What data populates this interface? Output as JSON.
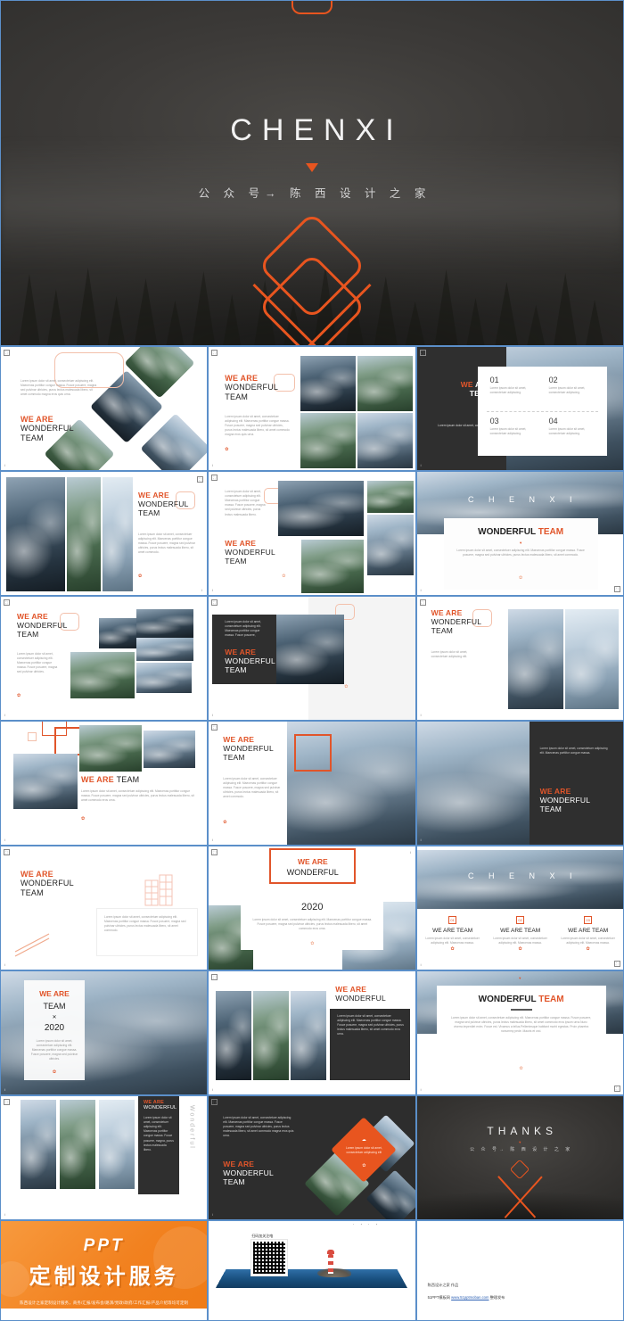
{
  "hero": {
    "title": "CHENXI",
    "subtitle": "公 众 号→ 陈 西 设 计 之 家",
    "caret_icon": "triangle-down-icon",
    "accent_color": "#e8551f",
    "background_color": "#3a3937"
  },
  "slides": [
    {
      "id": 1,
      "headline_orange": "WE ARE",
      "headline_dark": "WONDERFUL\nTEAM",
      "body": "Lorem ipsum dolor sit amet, consectetuer adipiscing elit. Maecenas porttitor congue massa. Fusce posuere, magna sed pulvinar ultricies, purus lectus malesuada libero, sit amet commodo magna eros quis urna.",
      "layout": "diamond-photo-collage"
    },
    {
      "id": 2,
      "headline_orange": "WE ARE",
      "headline_dark": "WONDERFUL\nTEAM",
      "body": "Lorem ipsum dolor sit amet, consectetuer adipiscing elit. Maecenas porttitor congue massa. Fusce posuere, magna sed pulvinar ultricies, purus lectus malesuada libero, sit amet commodo magna eros quis urna.",
      "layout": "left-text-photo-grid"
    },
    {
      "id": 3,
      "headline_orange": "WE",
      "headline_dark": "ARE\nTEAM",
      "body": "Lorem ipsum dolor sit amet, consectetuer adipiscing",
      "layout": "dark-panel-numbered-card",
      "cards": [
        {
          "number": "01",
          "text": "Lorem ipsum dolor sit amet, consectetuer adipiscing."
        },
        {
          "number": "02",
          "text": "Lorem ipsum dolor sit amet, consectetuer adipiscing."
        },
        {
          "number": "03",
          "text": "Lorem ipsum dolor sit amet, consectetuer adipiscing."
        },
        {
          "number": "04",
          "text": "Lorem ipsum dolor sit amet, consectetuer adipiscing."
        }
      ]
    },
    {
      "id": 4,
      "headline_orange": "WE ARE",
      "headline_dark": "WONDERFUL\nTEAM",
      "body": "Lorem ipsum dolor sit amet, consectetuer adipiscing elit. Maecenas porttitor congue massa. Fusce posuere, magna sed pulvinar ultricies, purus lectus malesuada libero, sit amet commodo.",
      "layout": "three-vertical-photos-right-text"
    },
    {
      "id": 5,
      "headline_orange": "WE ARE",
      "headline_dark": "WONDERFUL\nTEAM",
      "body": "Lorem ipsum dolor sit amet, consectetuer adipiscing elit. Maecenas porttitor congue massa. Fusce posuere, magna sed pulvinar ultricies, purus lectus malesuada libero.",
      "layout": "text-top-left-photo-grid"
    },
    {
      "id": 6,
      "title": "C H E N X I",
      "headline_dark": "WONDERFUL",
      "headline_orange": "TEAM",
      "body": "Lorem ipsum dolor sit amet, consectetuer adipiscing elit. Maecenas porttitor congue massa. Fusce posuere, magna sed pulvinar ultricies, purus lectus malesuada libero, sit amet commodo.",
      "layout": "full-photo-centered-card"
    },
    {
      "id": 7,
      "headline_orange": "WE ARE",
      "headline_dark": "WONDERFUL\nTEAM",
      "body": "Lorem ipsum dolor sit amet, consectetuer adipiscing elit. Maecenas porttitor congue massa. Fusce posuere, magna sed pulvinar ultricies.",
      "layout": "left-text-photo-mosaic"
    },
    {
      "id": 8,
      "headline_orange": "WE ARE",
      "headline_dark": "WONDERFUL\nTEAM",
      "body": "Lorem ipsum dolor sit amet, consectetuer adipiscing elit. Maecenas porttitor congue massa. Fusce posuere,",
      "layout": "dark-banner-wide-photo"
    },
    {
      "id": 9,
      "headline_orange": "WE ARE",
      "headline_dark": "WONDERFUL\nTEAM",
      "body": "Lorem ipsum dolor sit amet, consectetuer adipiscing elit.",
      "layout": "left-text-two-photos"
    },
    {
      "id": 10,
      "headline_orange": "WE ARE",
      "headline_dark": "TEAM",
      "body": "Lorem ipsum dolor sit amet, consectetuer adipiscing elit. Maecenas porttitor congue massa. Fusce posuere, magna sed pulvinar ultricies, purus lectus malesuada libero, sit amet commodo eros urna.",
      "layout": "orange-squares-photo-row"
    },
    {
      "id": 11,
      "headline_orange": "WE ARE",
      "headline_dark": "WONDERFUL\nTEAM",
      "body": "Lorem ipsum dolor sit amet, consectetuer adipiscing elit. Maecenas porttitor congue massa. Fusce posuere, magna sed pulvinar ultricies, purus lectus malesuada libero, sit amet commodo.",
      "layout": "left-text-orange-outline-photo"
    },
    {
      "id": 12,
      "headline_orange": "WE ARE",
      "headline_dark": "WONDERFUL\nTEAM",
      "body": "Lorem ipsum dolor sit amet, consectetuer adipiscing elit. Maecenas porttitor congue massa.",
      "layout": "photo-left-dark-text-right"
    },
    {
      "id": 13,
      "headline_orange": "WE ARE",
      "headline_dark": "WONDERFUL\nTEAM",
      "body": "Lorem ipsum dolor sit amet, consectetuer adipiscing elit. Maecenas porttitor congue massa. Fusce posuere, magna sed pulvinar ultricies, purus lectus malesuada libero, sit amet commodo.",
      "layout": "text-left-building-icon"
    },
    {
      "id": 14,
      "headline_orange": "WE ARE",
      "headline_dark": "WONDERFUL",
      "year": "2020",
      "body": "Lorem ipsum dolor sit amet, consectetuer adipiscing elit. Maecenas porttitor congue massa. Fusce posuere, magna sed pulvinar ultricies, purus lectus malesuada libero, sit amet commodo eros urna.",
      "layout": "orange-box-title-year"
    },
    {
      "id": 15,
      "title": "C H E N X I",
      "columns": [
        {
          "badge": "01",
          "heading": "WE ARE TEAM",
          "text": "Lorem ipsum dolor sit amet, consectetuer adipiscing elit. Maecenas massa."
        },
        {
          "badge": "02",
          "heading": "WE ARE TEAM",
          "text": "Lorem ipsum dolor sit amet, consectetuer adipiscing elit. Maecenas massa."
        },
        {
          "badge": "03",
          "heading": "WE ARE TEAM",
          "text": "Lorem ipsum dolor sit amet, consectetuer adipiscing elit. Maecenas massa."
        }
      ],
      "layout": "photo-header-three-columns"
    },
    {
      "id": 16,
      "headline_orange": "WE ARE",
      "headline_dark": "TEAM",
      "separator": "✕",
      "year": "2020",
      "body": "Lorem ipsum dolor sit amet, consectetuer adipiscing elit. Maecenas porttitor congue massa. Fusce posuere, magna sed pulvinar ultricies.",
      "layout": "vertical-card-over-photo"
    },
    {
      "id": 17,
      "headline_orange": "WE ARE",
      "headline_dark": "WONDERFUL",
      "body": "Lorem ipsum dolor sit amet, consectetuer adipiscing elit. Maecenas porttitor congue massa. Fusce posuere, magna sed pulvinar ultricies, purus lectus malesuada libero, sit amet commodo eros urna.",
      "layout": "photo-columns-dark-text-card"
    },
    {
      "id": 18,
      "headline_dark": "WONDERFUL",
      "headline_orange": "TEAM",
      "body": "Lorem ipsum dolor sit amet, consectetuer adipiscing elit. Maecenas porttitor congue massa. Fusce posuere, magna sed pulvinar ultricies, purus lectus malesuada libero, sit amet commodo eros ipsum urna.Nunc viverra imperdiet enim. Fusce est. Vivamus a tellus.Pellentesque habitant morbi egestas. Proin pharetra nonummy pede. Mauris et orci.",
      "layout": "centered-white-card-over-photo"
    },
    {
      "id": 19,
      "headline_orange": "WE ARE",
      "headline_dark": "WONDERFUL",
      "vertical_word": "Wonderful",
      "body": "Lorem ipsum dolor sit amet, consectetuer adipiscing elit. Maecenas porttitor congue massa. Fusce posuere, magna, purus lectus malesuada libero.",
      "layout": "photo-strips-dark-sidebar"
    },
    {
      "id": 20,
      "headline_orange": "WE ARE",
      "headline_dark": "WONDERFUL\nTEAM",
      "body": "Lorem ipsum dolor sit amet, consectetuer adipiscing elit. Maecenas porttitor congue massa. Fusce posuere, magna sed pulvinar ultricies, purus lectus malesuada libero, sit amet commodo magna eros quis urna.",
      "diamond_text": "Lorem ipsum dolor sit amet, consectetuer adipiscing elit",
      "layout": "dark-diamond-collage"
    },
    {
      "id": 21,
      "title": "THANKS",
      "subtitle": "公 众 号→ 陈 西 设 计 之 家",
      "layout": "dark-closing-slide"
    }
  ],
  "footer": {
    "banner": {
      "title_en": "PPT",
      "title_cn": "定制设计服务",
      "note": "陈西设计之家定制设计服务，商务/汇报/发布会/路演/党政/政府/工作汇报/产品介绍等均可定制",
      "background_color": "#f2811f"
    },
    "qr": {
      "caption": "扫码加关注咯",
      "alt": "qr-code"
    },
    "credit": {
      "line1": "陈西设计之家  作品",
      "line2_prefix": "51PPT模板网",
      "line2_link": "www.51pptmoban.com",
      "line2_suffix": "整理发布"
    }
  }
}
